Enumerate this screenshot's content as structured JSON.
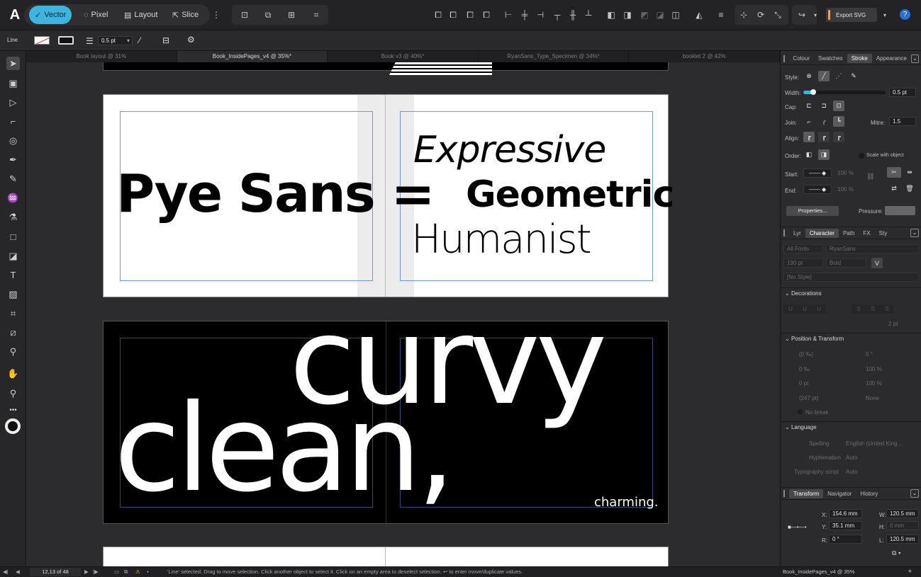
{
  "app": {
    "logo": "A"
  },
  "personas": [
    {
      "label": "Vector",
      "active": true
    },
    {
      "label": "Pixel"
    },
    {
      "label": "Layout"
    },
    {
      "label": "Slice"
    }
  ],
  "toolbar": {
    "export_label": "Export SVG"
  },
  "context": {
    "mode_label": "Line",
    "stroke_width": "0.5 pt"
  },
  "tabs": [
    "Book layout @ 31%",
    "Book_InsidePages_v4 @ 35%*",
    "Book v3 @ 40%*",
    "RyanSans_Type_Specimen @ 34%*",
    "booklet 2 @ 42%"
  ],
  "spread1": {
    "left_text": "Pye Sans =",
    "line1": "Expressive",
    "line2": "Geometric",
    "line3": "Humanist"
  },
  "spread2": {
    "word1": "curvy",
    "word2": "clean,",
    "word3": "charming."
  },
  "stroke_panel": {
    "tabs": [
      "Colour",
      "Swatches",
      "Stroke",
      "Appearance"
    ],
    "style_label": "Style:",
    "width_label": "Width:",
    "width_value": "0.5 pt",
    "cap_label": "Cap:",
    "join_label": "Join:",
    "mitre_label": "Mitre:",
    "mitre_value": "1.5",
    "align_label": "Align:",
    "order_label": "Order:",
    "scale_label": "Scale with object",
    "start_label": "Start:",
    "end_label": "End:",
    "start_pct": "100 %",
    "end_pct": "100 %",
    "properties_btn": "Properties...",
    "pressure_label": "Pressure:"
  },
  "char_panel": {
    "tabs": [
      "Lyr",
      "Character",
      "Path",
      "FX",
      "Sty"
    ],
    "font_collection": "All Fonts",
    "font_name": "RyanSans",
    "size": "190 pt",
    "weight": "Bold",
    "style": "[No Style]",
    "decorations": "Decorations",
    "pt_value": "2 pt",
    "pos_transform": "Position & Transform",
    "pt_fields": [
      "(0 ‰)",
      "0 °",
      "0 ‰",
      "100 %",
      "0 pt",
      "100 %",
      "(247 pt)",
      "None"
    ],
    "no_break": "No break",
    "language": "Language",
    "spelling_label": "Spelling",
    "spelling_value": "English (United King...",
    "hyph_label": "Hyphenation",
    "hyph_value": "Auto",
    "typo_label": "Typography script",
    "typo_value": "Auto"
  },
  "transform_panel": {
    "tabs": [
      "Transform",
      "Navigator",
      "History"
    ],
    "x_label": "X:",
    "x_value": "154.6 mm",
    "y_label": "Y:",
    "y_value": "35.1 mm",
    "w_label": "W:",
    "w_value": "120.5 mm",
    "h_label": "H:",
    "h_value": "0 mm",
    "r_label": "R:",
    "r_value": "0 °",
    "l_label": "L:",
    "l_value": "120.5 mm"
  },
  "status": {
    "page": "12,13 of 48",
    "message": "'Line' selected. Drag to move selection. Click another object to select it. Click on an empty area to deselect selection. ↩ to enter move/duplicate values.",
    "doc_name": "Book_InsidePages_v4 @ 35%"
  },
  "colors": {
    "accent": "#3db5e0",
    "export_swatch": "#e8a25c"
  }
}
